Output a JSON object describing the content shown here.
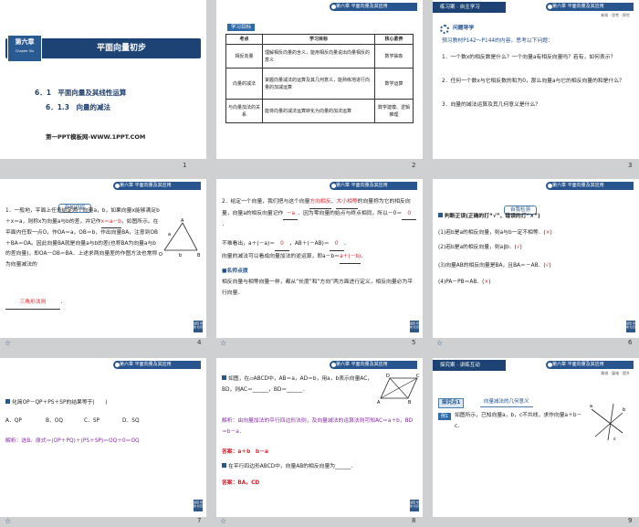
{
  "colors": {
    "accent": "#29558e",
    "answer": "#d6232a"
  },
  "icons": {
    "nav": "speaker-icon",
    "corner": "return-icon"
  },
  "nav_label": "☆",
  "numbers": [
    "1",
    "2",
    "3",
    "4",
    "5",
    "6",
    "7",
    "8",
    "9"
  ],
  "corner_label": "返回\n导航\n栏目",
  "header": "第六章  平面向量及其应用",
  "s1": {
    "badge_top": "第六章",
    "badge_sub": "Chapter Six",
    "title": "平面向量初步",
    "sec1": "6．1　平面向量及其线性运算",
    "sec2": "6．1.3　向量的减法",
    "footer": "第一PPT模板网-WWW.1PPT.COM"
  },
  "s2": {
    "tag": "学习目标",
    "head": [
      "考点",
      "学习目标",
      "核心素养"
    ],
    "rows": [
      [
        "相反向量",
        "理解相反向量的含义，能用相反向量说出向量相反的意义",
        "数学抽象"
      ],
      [
        "向量的减法",
        "掌握向量减法的运算及其几何意义，能熟练地进行向量的加减运算",
        "数学运算"
      ],
      [
        "与向量加法的关系",
        "能将向量的减法运算转化为向量的加法运算",
        "数学建模、逻辑推理"
      ]
    ]
  },
  "s3": {
    "tag": "练习案 · 自主学习",
    "subtag": "新知 · 思考 · 探究",
    "guide": "问题导学",
    "intro": "预习教材P142～P144的内容，思考以下问题：",
    "q1": "1．一个数x的相反数是什么？一个向量a有相反向量吗？若有，如何表示？",
    "q2": "2．任何一个数x与它相反数的和为0，那么向量a与它的相反向量的和是什么？",
    "q3": "3．向量的减法运算及其几何意义是什么？"
  },
  "s4": {
    "tag": "新知初探",
    "p1": "1．一般地，平面上任意给定两个向量a，b，如果向量x能够满足b＋x＝a，则称x为向量a与b的差，并记作",
    "a1": "x＝a－b",
    "p2": "，如图所示。在平面内任取一点O，作OA＝a，OB＝b，作出向量BA，注意到OB＋BA＝OA。因此向量BA就是向量a与b的差(也称BA为向量a与b的差向量)，即OA－OB＝BA．上述求两向量差的作图方法也常称为向量减法的",
    "a2": "三角形法则",
    "p3": "．",
    "fig": [
      "A",
      "B",
      "O",
      "a",
      "b"
    ]
  },
  "s5": {
    "p1": "2．给定一个向量，我们把与这个向量",
    "a1": "方向相反",
    "p2": "、",
    "a2": "大小相等",
    "p3": "的向量称为它的相反向量，向量a的相反向量记作",
    "a3": "－a",
    "p4": "．因为零向量的始点与终点相同，所以－0＝",
    "a4": "0",
    "p5": "．",
    "l2a": "不难看出，a＋(－a)＝",
    "a5": "0",
    "l2b": "，AB＋(－AB)＝",
    "a6": "0",
    "l2c": "．",
    "l3a": "向量的减法可以看成向量加法的逆运算，即a－b＝",
    "a7": "a＋(－b)",
    "l3b": "．",
    "note_title": "■名师点拨",
    "note": "相反向量与相等向量一样，都从“长度”和“方向”两方面进行定义，相反向量必为平行向量．"
  },
  "s6": {
    "tag": "自我检测",
    "p0": "判断正误(正确的打“√”，错误的打“×”)",
    "i1": "(1)若b是a的相反向量，则a与b一定不相等．(",
    "a1": "×",
    "i2": "(2)若b是a的相反向量，则a∥b．(",
    "a2": "√",
    "i3": "(3)向量AB的相反向量是BA，且BA＝－AB．(",
    "a3": "√",
    "i4": "(4)PA－PB＝AB．(",
    "a4": "×",
    "close": ")"
  },
  "s7": {
    "q": "化简OP－QP＋PS＋SP的结果等于(　　)",
    "opts": [
      "A．QP",
      "B．OQ",
      "C．SP",
      "D．SQ"
    ],
    "sol": "解析：选B．原式＝(OP＋PQ)＋(PS＋SP)＝OQ＋0＝OQ"
  },
  "s8": {
    "q1": "如图，在▱ABCD中，AB＝a，AD＝b，用a，b表示向量AC，BD，则AC＝______，BD＝______．",
    "sol1": "解析：由向量加法的平行四边形法则，及向量减法的运算法则可知AC＝a＋b，BD＝b－a．",
    "ans1": "答案：a＋b　b－a",
    "q2": "在平行四边形ABCD中，向量AB的相反向量为______．",
    "ans2": "答案：BA，CD",
    "fig": [
      "A",
      "B",
      "C",
      "D"
    ]
  },
  "s9": {
    "tag": "探究案 · 讲练互动",
    "subtag": "解惑 · 疑难 · 提升",
    "point": "探究点1",
    "point_title": "向量减法的几何意义",
    "ex_tag": "例1",
    "ex": "如图所示，已知向量a，b，c不共线，求作向量a＋b－c．",
    "fig": [
      "a",
      "b",
      "c"
    ]
  }
}
